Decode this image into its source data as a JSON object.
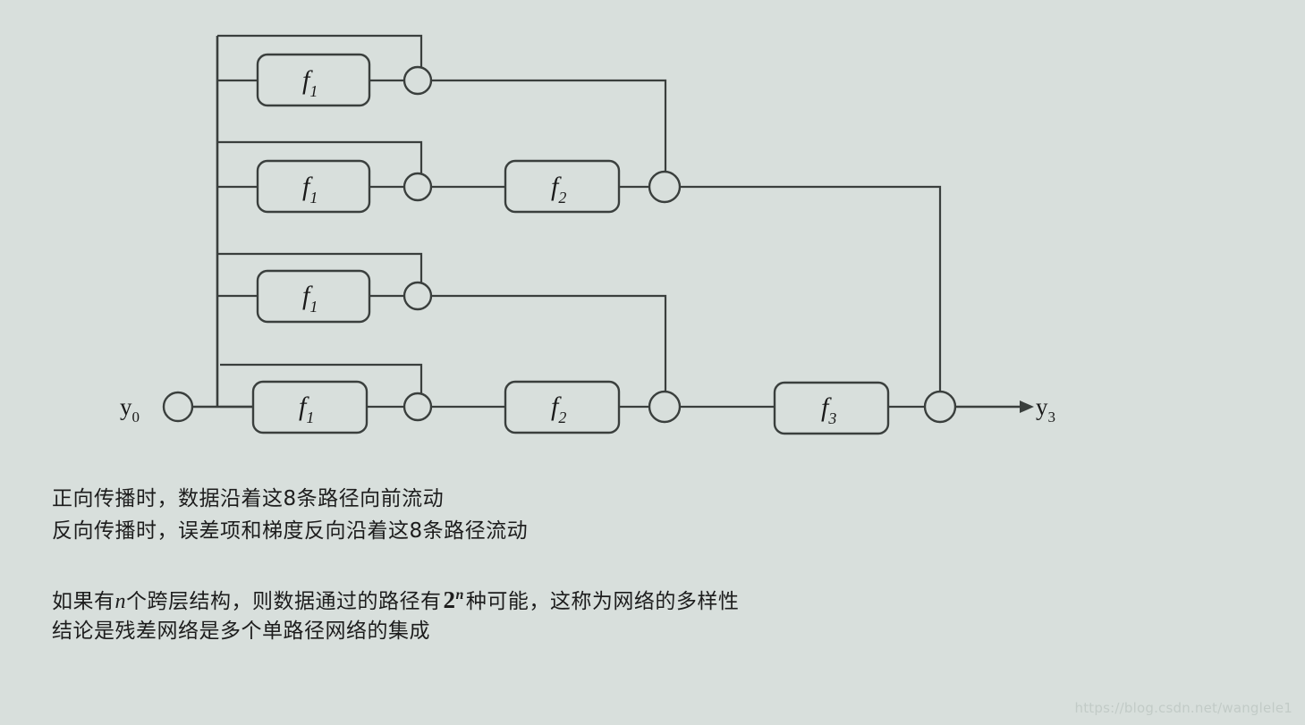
{
  "page": {
    "background_color": "#d8dfdc",
    "line_color": "#3a3f3d",
    "text_color": "#1d1d1d"
  },
  "diagram": {
    "title": "residual-network-unraveled-paths",
    "input_label": "y",
    "input_sub": "0",
    "output_label": "y",
    "output_sub": "3",
    "rows": [
      {
        "id": "row-1",
        "block_label": "f",
        "block_sub": "1"
      },
      {
        "id": "row-2",
        "block_label": "f",
        "block_sub": "1"
      },
      {
        "id": "row-3",
        "block_label": "f",
        "block_sub": "1"
      },
      {
        "id": "row-4",
        "block_label": "f",
        "block_sub": "1"
      }
    ],
    "stage2_blocks": [
      {
        "id": "f2-upper",
        "label": "f",
        "sub": "2"
      },
      {
        "id": "f2-lower",
        "label": "f",
        "sub": "2"
      }
    ],
    "stage3_blocks": [
      {
        "id": "f3",
        "label": "f",
        "sub": "3"
      }
    ]
  },
  "captions": {
    "line1": "正向传播时，数据沿着这8条路径向前流动",
    "line2": "反向传播时，误差项和梯度反向沿着这8条路径流动",
    "line3_part1": "如果有",
    "line3_var": "n",
    "line3_part2": "个跨层结构，则数据通过的路径有",
    "line3_power_base": "2",
    "line3_power_exp": "n",
    "line3_part3": "种可能，这称为网络的多样性",
    "line4": "结论是残差网络是多个单路径网络的集成"
  },
  "watermark": {
    "text": "https://blog.csdn.net/wanglele1"
  }
}
